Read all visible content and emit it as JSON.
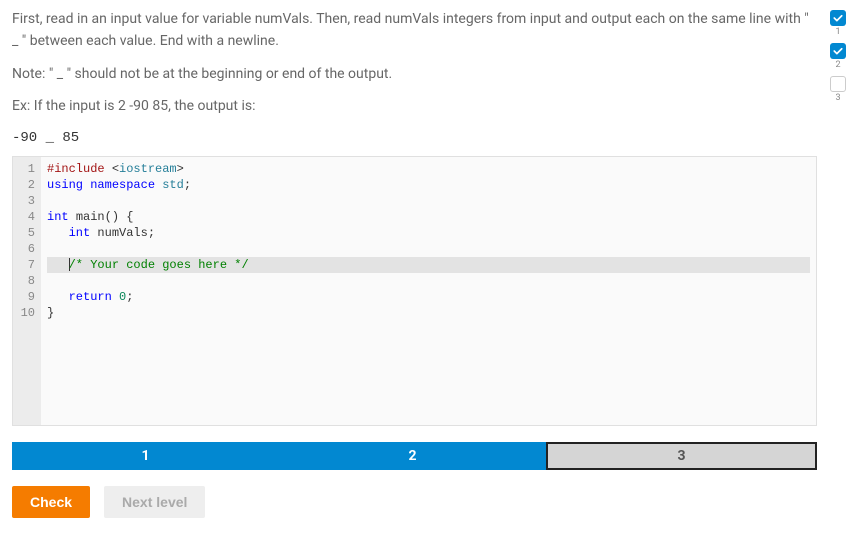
{
  "problem": {
    "line1": "First, read in an input value for variable numVals. Then, read numVals integers from input and output each on the same line with \" _ \" between each value. End with a newline.",
    "line2": "Note: \" _ \" should not be at the beginning or end of the output.",
    "line3": "Ex: If the input is 2 -90 85, the output is:",
    "example_output": "-90 _ 85"
  },
  "code": {
    "lines": [
      {
        "n": "1",
        "tokens": [
          [
            "pre",
            "#include "
          ],
          [
            "punc",
            "<"
          ],
          [
            "ns",
            "iostream"
          ],
          [
            "punc",
            ">"
          ]
        ]
      },
      {
        "n": "2",
        "tokens": [
          [
            "kw",
            "using "
          ],
          [
            "kw",
            "namespace "
          ],
          [
            "ns",
            "std"
          ],
          [
            "punc",
            ";"
          ]
        ]
      },
      {
        "n": "3",
        "tokens": []
      },
      {
        "n": "4",
        "tokens": [
          [
            "type",
            "int "
          ],
          [
            "id",
            "main"
          ],
          [
            "punc",
            "() {"
          ]
        ]
      },
      {
        "n": "5",
        "tokens": [
          [
            "id",
            "   "
          ],
          [
            "type",
            "int "
          ],
          [
            "id",
            "numVals"
          ],
          [
            "punc",
            ";"
          ]
        ]
      },
      {
        "n": "6",
        "tokens": []
      },
      {
        "n": "7",
        "highlighted": true,
        "cursor": true,
        "tokens": [
          [
            "id",
            "   "
          ],
          [
            "com",
            "/* Your code goes here */"
          ]
        ]
      },
      {
        "n": "8",
        "tokens": []
      },
      {
        "n": "9",
        "tokens": [
          [
            "id",
            "   "
          ],
          [
            "kw",
            "return "
          ],
          [
            "num",
            "0"
          ],
          [
            "punc",
            ";"
          ]
        ]
      },
      {
        "n": "10",
        "tokens": [
          [
            "punc",
            "}"
          ]
        ]
      }
    ]
  },
  "steps": {
    "items": [
      {
        "label": "1",
        "state": "done"
      },
      {
        "label": "2",
        "state": "done"
      },
      {
        "label": "3",
        "state": "active"
      }
    ]
  },
  "buttons": {
    "check": "Check",
    "next": "Next level"
  },
  "sidebar": {
    "checks": [
      {
        "num": "1",
        "checked": true
      },
      {
        "num": "2",
        "checked": true
      },
      {
        "num": "3",
        "checked": false
      }
    ]
  }
}
